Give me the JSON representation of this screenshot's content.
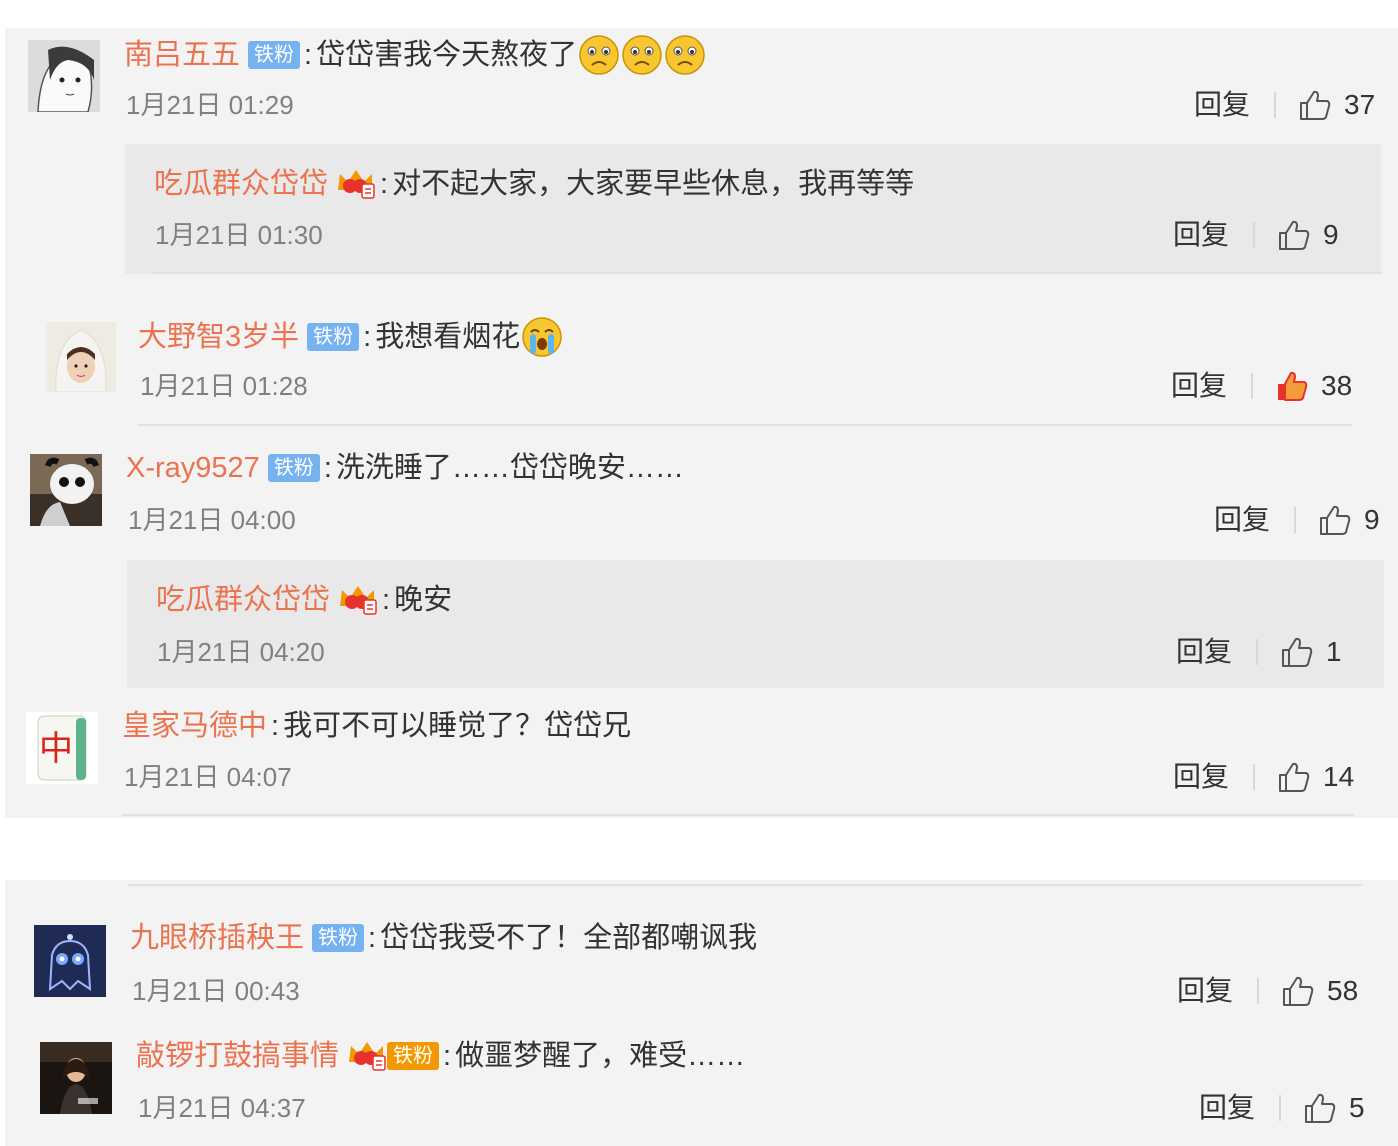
{
  "top_comments": [
    {
      "user": "南吕五五",
      "badge": "铁粉",
      "text": "岱岱害我今天熬夜了",
      "emojis": [
        "sad",
        "sad",
        "sad"
      ],
      "time": "1月21日 01:29",
      "reply": "回复",
      "likes": "37",
      "liked": false,
      "replies": [
        {
          "user": "吃瓜群众岱岱",
          "vip": true,
          "text": "对不起大家，大家要早些休息，我再等等",
          "time": "1月21日 01:30",
          "reply": "回复",
          "likes": "9"
        }
      ]
    },
    {
      "user": "大野智3岁半",
      "badge": "铁粉",
      "text": "我想看烟花",
      "emojis": [
        "cry"
      ],
      "time": "1月21日 01:28",
      "reply": "回复",
      "likes": "38",
      "liked": true
    },
    {
      "user": "X-ray9527",
      "badge": "铁粉",
      "text": "洗洗睡了……岱岱晚安……",
      "time": "1月21日 04:00",
      "reply": "回复",
      "likes": "9",
      "liked": false,
      "replies": [
        {
          "user": "吃瓜群众岱岱",
          "vip": true,
          "text": "晚安",
          "time": "1月21日 04:20",
          "reply": "回复",
          "likes": "1"
        }
      ]
    },
    {
      "user": "皇家马德中",
      "text": "我可不可以睡觉了？岱岱兄",
      "avatar_text": "中",
      "time": "1月21日 04:07",
      "reply": "回复",
      "likes": "14",
      "liked": false
    }
  ],
  "bottom_comments": [
    {
      "user": "九眼桥插秧王",
      "badge": "铁粉",
      "text": "岱岱我受不了！全部都嘲讽我",
      "time": "1月21日 00:43",
      "reply": "回复",
      "likes": "58"
    },
    {
      "user": "敲锣打鼓搞事情",
      "vip": true,
      "badge": "铁粉",
      "text": "做噩梦醒了，难受……",
      "time": "1月21日 04:37",
      "reply": "回复",
      "likes": "5"
    }
  ],
  "colors": {
    "username": "#eb7350",
    "badge": "#76b1f0",
    "liked": "#e8332c",
    "time": "#808080"
  },
  "icons": [
    "thumb-up-icon",
    "vip-crown-icon",
    "sad-face-emoji-icon",
    "crying-face-emoji-icon"
  ]
}
